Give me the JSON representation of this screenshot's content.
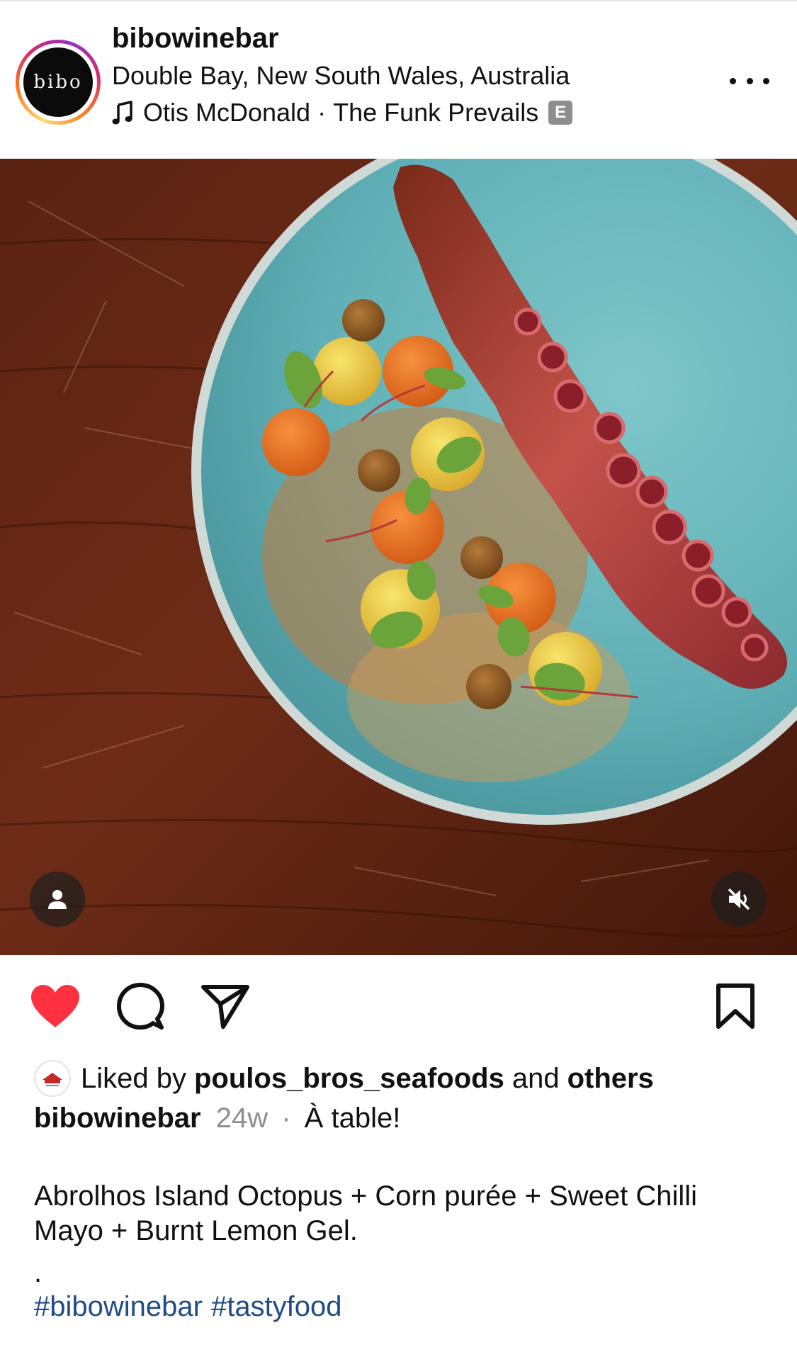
{
  "post": {
    "username": "bibowinebar",
    "location": "Double Bay, New South Wales, Australia",
    "audio": {
      "artist": "Otis McDonald",
      "separator": "·",
      "track": "The Funk Prevails",
      "explicit_badge": "E"
    },
    "avatar_logo_text": "bibo",
    "more_icon": "more-horizontal-icon"
  },
  "image": {
    "description_icons": {
      "tag": "user-tag-icon",
      "mute": "speaker-muted-icon"
    }
  },
  "actions": {
    "like_icon": "heart-filled-icon",
    "comment_icon": "comment-bubble-icon",
    "share_icon": "paper-plane-icon",
    "save_icon": "bookmark-icon",
    "liked": true,
    "like_color": "#ff3040"
  },
  "likes": {
    "prefix": "Liked by",
    "user": "poulos_bros_seafoods",
    "conjunction": "and",
    "others": "others"
  },
  "caption": {
    "username": "bibowinebar",
    "age": "24w",
    "separator": "·",
    "title": "À table!",
    "body": "Abrolhos Island Octopus + Corn purée + Sweet Chilli Mayo + Burnt Lemon Gel.",
    "dot": ".",
    "hashtags": [
      "#bibowinebar",
      "#tastyfood"
    ],
    "hashtag_color": "#1f4c86"
  }
}
